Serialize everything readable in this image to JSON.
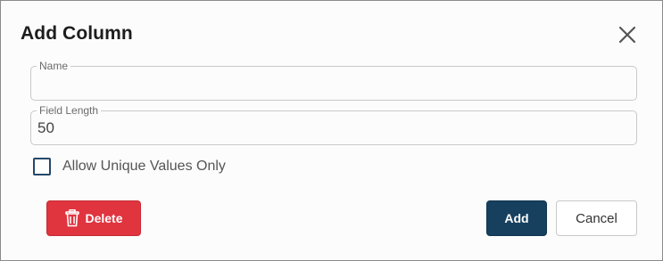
{
  "dialog": {
    "title": "Add Column",
    "close_icon": "close-icon"
  },
  "fields": {
    "name": {
      "label": "Name",
      "value": ""
    },
    "field_length": {
      "label": "Field Length",
      "value": "50"
    }
  },
  "unique_checkbox": {
    "label": "Allow Unique Values Only",
    "checked": false
  },
  "buttons": {
    "delete_label": "Delete",
    "delete_icon": "trash-icon",
    "add_label": "Add",
    "cancel_label": "Cancel"
  },
  "colors": {
    "delete": "#e0343f",
    "primary": "#17405f",
    "checkbox_border": "#24486a"
  }
}
